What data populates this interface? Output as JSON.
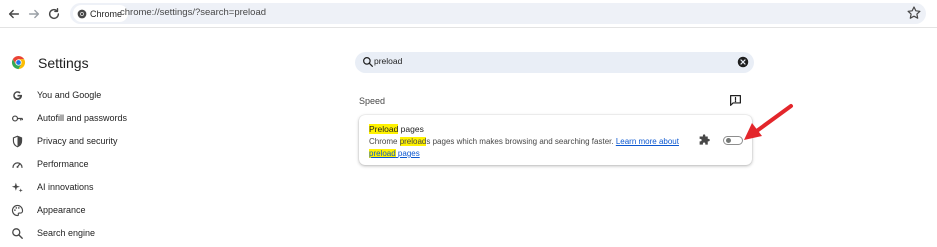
{
  "toolbar": {
    "chip_label": "Chrome",
    "url": "chrome://settings/?search=preload",
    "back_icon": "back-arrow-icon",
    "forward_icon": "forward-arrow-icon",
    "reload_icon": "reload-icon",
    "bookmark_icon": "star-icon"
  },
  "sidebar": {
    "title": "Settings",
    "items": [
      {
        "label": "You and Google",
        "icon": "google-icon"
      },
      {
        "label": "Autofill and passwords",
        "icon": "key-icon"
      },
      {
        "label": "Privacy and security",
        "icon": "shield-icon"
      },
      {
        "label": "Performance",
        "icon": "speedometer-icon"
      },
      {
        "label": "AI innovations",
        "icon": "sparkle-icon"
      },
      {
        "label": "Appearance",
        "icon": "palette-icon"
      },
      {
        "label": "Search engine",
        "icon": "search-icon"
      }
    ]
  },
  "search": {
    "value": "preload"
  },
  "section": {
    "title": "Speed"
  },
  "card": {
    "title_highlight": "Preload",
    "title_rest": " pages",
    "desc_prefix": "Chrome ",
    "desc_highlight": "preload",
    "desc_rest": "s pages which makes browsing and searching faster. ",
    "link_prefix": "Learn more about ",
    "link_highlight": "preload",
    "link_suffix": "pages",
    "toggle_on": false
  },
  "colors": {
    "highlight": "#fff200",
    "link": "#0b57d0",
    "annotation_arrow": "#e3262b"
  }
}
